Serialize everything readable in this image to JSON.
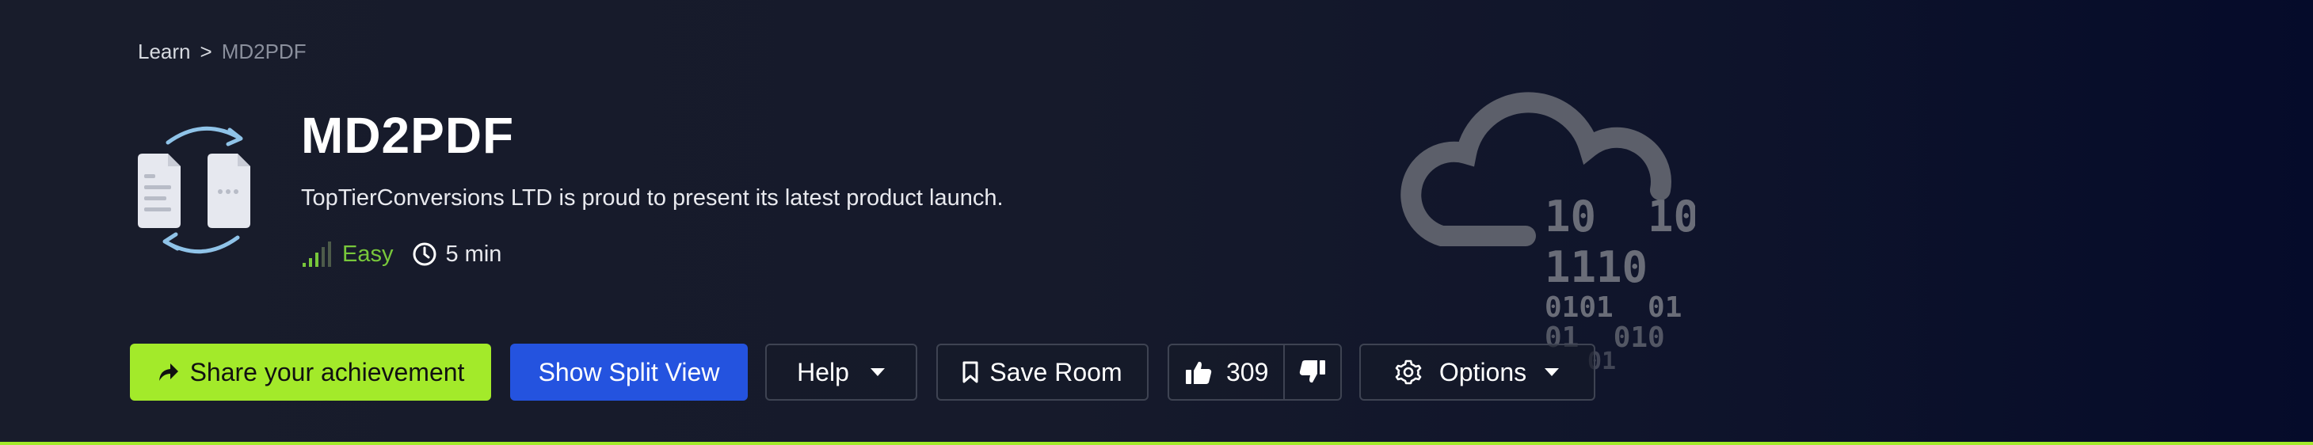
{
  "breadcrumb": {
    "parent": "Learn",
    "separator": ">",
    "current": "MD2PDF"
  },
  "room": {
    "title": "MD2PDF",
    "description": "TopTierConversions LTD is proud to present its latest product launch.",
    "difficulty": "Easy",
    "duration": "5 min"
  },
  "art": {
    "binary_lines": [
      "10  10",
      "1110",
      "0101  01",
      "01  010",
      "01"
    ]
  },
  "actions": {
    "share_label": "Share your achievement",
    "split_label": "Show Split View",
    "help_label": "Help",
    "save_label": "Save Room",
    "like_count": "309",
    "options_label": "Options"
  },
  "icons": {
    "share": "share-arrow-icon",
    "save": "bookmark-icon",
    "like": "thumbs-up-icon",
    "dislike": "thumbs-down-icon",
    "options": "gear-icon",
    "dropdown": "chevron-down-icon",
    "difficulty": "signal-bars-icon",
    "duration": "clock-icon"
  },
  "colors": {
    "accent_green": "#a3ea2a",
    "primary_blue": "#2453df",
    "difficulty_easy": "#78c73b",
    "background": "#161a2b"
  }
}
